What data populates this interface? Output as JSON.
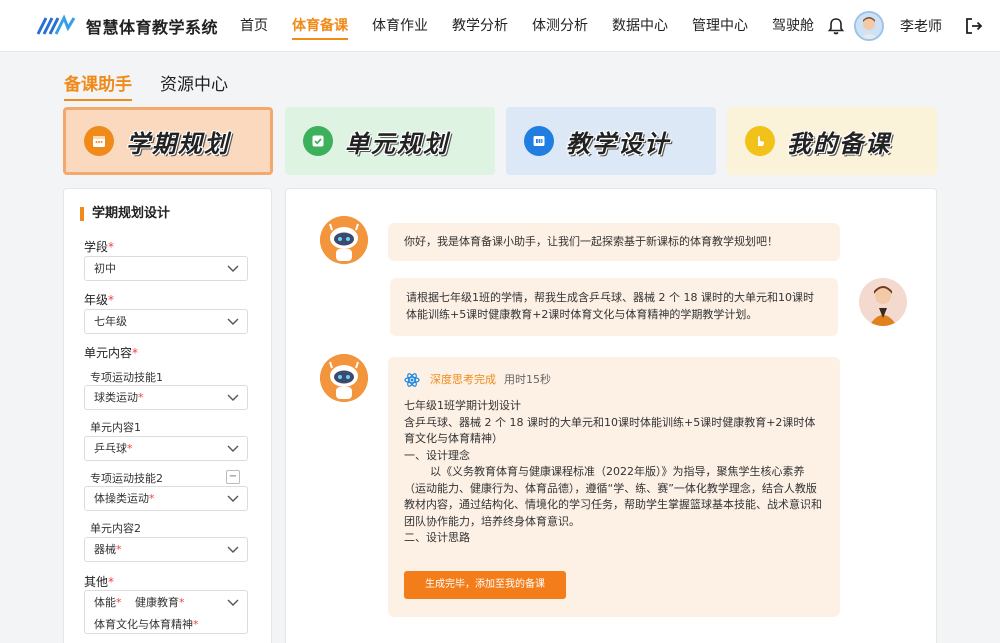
{
  "app": {
    "title": "智慧体育教学系统"
  },
  "nav": {
    "items": [
      "首页",
      "体育备课",
      "体育作业",
      "教学分析",
      "体测分析",
      "数据中心",
      "管理中心",
      "驾驶舱"
    ],
    "active_index": 1
  },
  "user": {
    "name": "李老师"
  },
  "subtabs": {
    "items": [
      "备课助手",
      "资源中心"
    ],
    "active_index": 0
  },
  "modes": [
    {
      "label": "学期规划",
      "icon": "calendar-icon",
      "color": "#f08a1a"
    },
    {
      "label": "单元规划",
      "icon": "check-square-icon",
      "color": "#3cb05a"
    },
    {
      "label": "教学设计",
      "icon": "book-icon",
      "color": "#1f7ee0"
    },
    {
      "label": "我的备课",
      "icon": "hand-icon",
      "color": "#f2c21a"
    }
  ],
  "form": {
    "title": "学期规划设计",
    "stage_label": "学段",
    "stage_value": "初中",
    "grade_label": "年级",
    "grade_value": "七年级",
    "unit_label": "单元内容",
    "skill1_label": "专项运动技能1",
    "skill1_value": "球类运动",
    "unit1_label": "单元内容1",
    "unit1_value": "乒乓球",
    "skill2_label": "专项运动技能2",
    "skill2_value": "体操类运动",
    "unit2_label": "单元内容2",
    "unit2_value": "器械",
    "other_label": "其他",
    "other_value_1": "体能",
    "other_value_2": "健康教育",
    "other_value_3": "体育文化与体育精神",
    "minus_symbol": "−",
    "required_mark": "*"
  },
  "chat": {
    "bot_greeting": "你好，我是体育备课小助手，让我们一起探索基于新课标的体育教学规划吧！",
    "user_request": "请根据七年级1班的学情，帮我生成含乒乓球、器械 2 个 18 课时的大单元和10课时体能训练+5课时健康教育+2课时体育文化与体育精神的学期教学计划。",
    "thinking_status": "深度思考完成",
    "thinking_time": "用时15秒",
    "answer_lines": [
      "七年级1班学期计划设计",
      "含乒乓球、器械 2 个 18 课时的大单元和10课时体能训练+5课时健康教育+2课时体育文化与体育精神）",
      "一、设计理念"
    ],
    "answer_paragraph": "以《义务教育体育与健康课程标准（2022年版）》为指导，聚焦学生核心素养（运动能力、健康行为、体育品德），遵循“学、练、赛”一体化教学理念，结合人教版教材内容，通过结构化、情境化的学习任务，帮助学生掌握篮球基本技能、战术意识和团队协作能力，培养终身体育意识。",
    "answer_tail": "二、设计思路",
    "action_button": "生成完毕，添加至我的备课"
  },
  "colors": {
    "accent": "#f08a1a",
    "bubble_bg": "#fdf1e6"
  }
}
